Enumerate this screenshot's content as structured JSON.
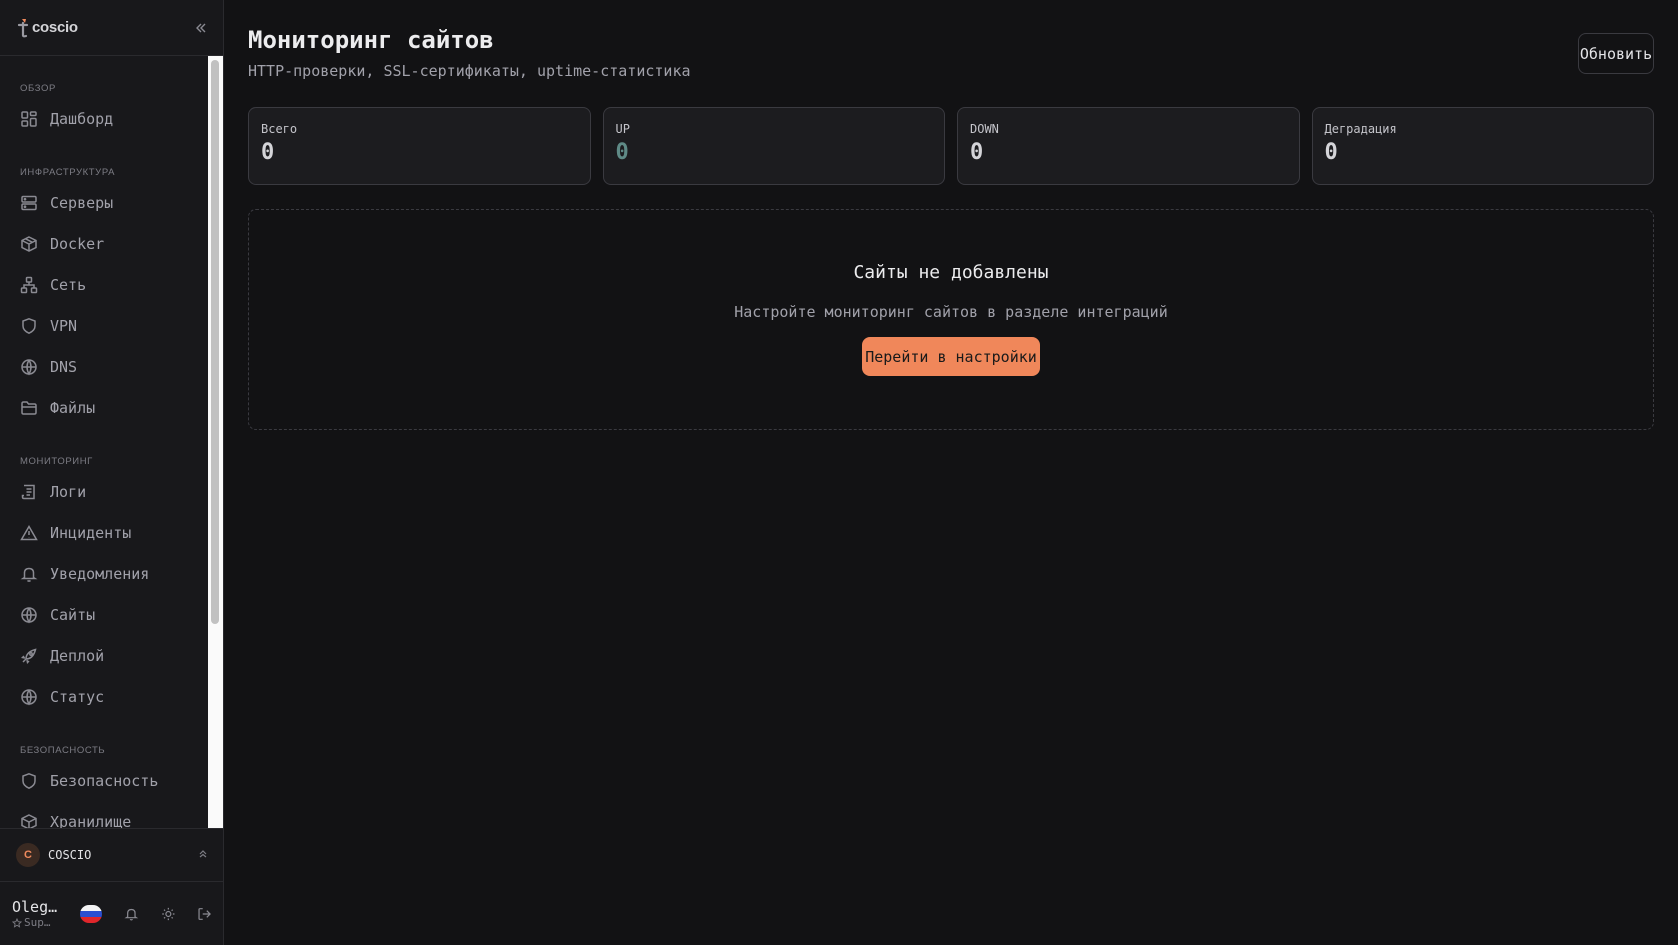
{
  "app": {
    "logo_text": "coscio",
    "logo_icon": "coscio-logo"
  },
  "sidebar": {
    "sections": [
      {
        "title": "ОБЗОР",
        "items": [
          {
            "label": "Дашборд",
            "icon": "grid-icon"
          }
        ]
      },
      {
        "title": "ИНФРАСТРУКТУРА",
        "items": [
          {
            "label": "Серверы",
            "icon": "server-icon"
          },
          {
            "label": "Docker",
            "icon": "box-icon"
          },
          {
            "label": "Сеть",
            "icon": "network-icon"
          },
          {
            "label": "VPN",
            "icon": "shield-icon"
          },
          {
            "label": "DNS",
            "icon": "globe-icon"
          },
          {
            "label": "Файлы",
            "icon": "folder-icon"
          }
        ]
      },
      {
        "title": "МОНИТОРИНГ",
        "items": [
          {
            "label": "Логи",
            "icon": "logs-icon"
          },
          {
            "label": "Инциденты",
            "icon": "alert-triangle-icon"
          },
          {
            "label": "Уведомления",
            "icon": "bell-icon"
          },
          {
            "label": "Сайты",
            "icon": "globe-icon"
          },
          {
            "label": "Деплой",
            "icon": "rocket-icon"
          },
          {
            "label": "Статус",
            "icon": "globe-icon"
          }
        ]
      },
      {
        "title": "БЕЗОПАСНОСТЬ",
        "items": [
          {
            "label": "Безопасность",
            "icon": "shield-icon"
          },
          {
            "label": "Хранилище",
            "icon": "box-icon"
          }
        ]
      }
    ],
    "org": {
      "initial": "C",
      "name": "COSCIO"
    },
    "user": {
      "name": "Oleg…",
      "role": "Sup…"
    }
  },
  "page": {
    "title": "Мониторинг сайтов",
    "subtitle": "HTTP-проверки, SSL-сертификаты, uptime-статистика",
    "refresh_label": "Обновить"
  },
  "stats": [
    {
      "label": "Всего",
      "value": "0"
    },
    {
      "label": "UP",
      "value": "0"
    },
    {
      "label": "DOWN",
      "value": "0"
    },
    {
      "label": "Деградация",
      "value": "0"
    }
  ],
  "empty_state": {
    "title": "Сайты не добавлены",
    "description": "Настройте мониторинг сайтов в разделе интеграций",
    "button_label": "Перейти в настройки"
  },
  "colors": {
    "accent": "#f0875a",
    "up_value": "#5f8a86",
    "background": "#121214"
  }
}
